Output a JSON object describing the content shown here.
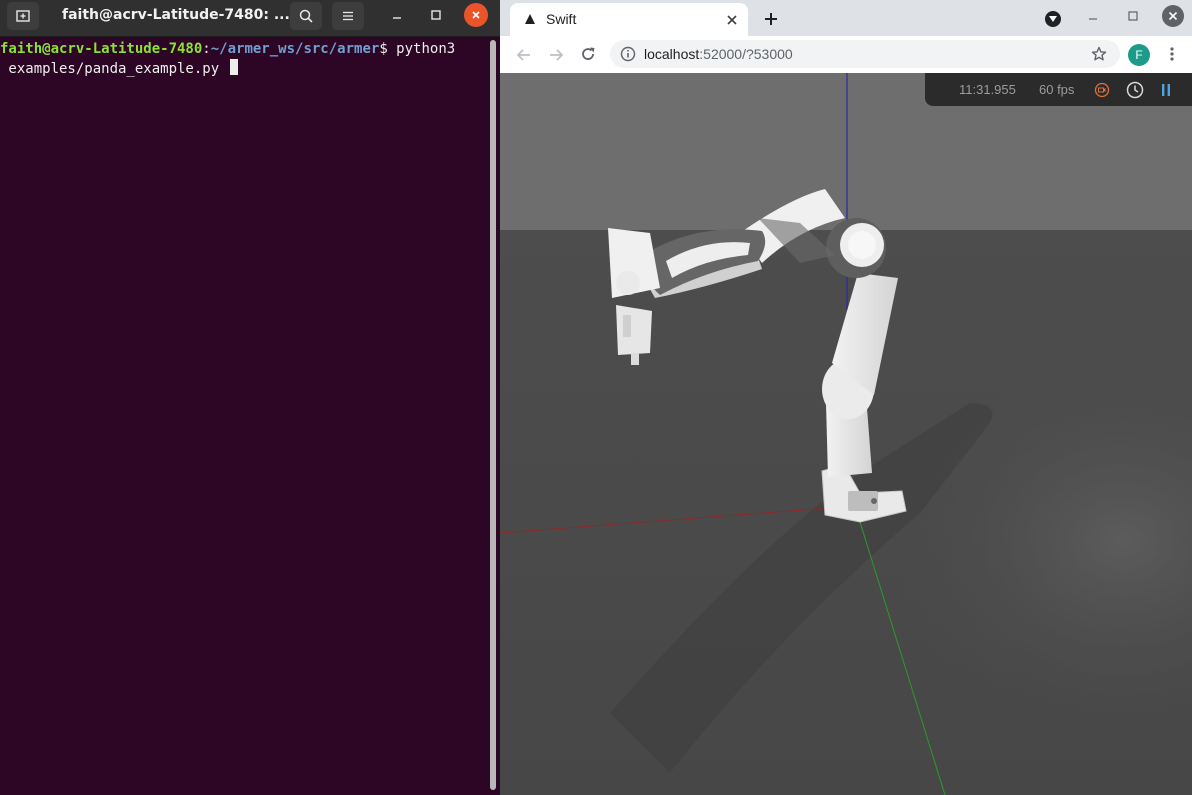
{
  "terminal": {
    "title": "faith@acrv-Latitude-7480: ...",
    "prompt_user": "faith@acrv-Latitude-7480",
    "prompt_sep": ":",
    "prompt_path": "~/armer_ws/src/armer",
    "prompt_symbol": "$",
    "command_line1": " python3",
    "command_line2": " examples/panda_example.py ",
    "buttons": [
      "new-tab-icon",
      "search-icon",
      "hamburger-menu-icon",
      "minimize-icon",
      "maximize-icon",
      "close-icon"
    ]
  },
  "browser": {
    "tab_title": "Swift",
    "url_host": "localhost",
    "url_rest": ":52000/?53000",
    "profile_initial": "F",
    "colors": {
      "profile": "#1c9a8a",
      "record": "#e0703e",
      "pause": "#4fa3e0"
    }
  },
  "swift": {
    "time": "11:31.955",
    "fps": "60 fps",
    "controls": [
      "record-icon",
      "clock-icon",
      "pause-icon"
    ]
  }
}
